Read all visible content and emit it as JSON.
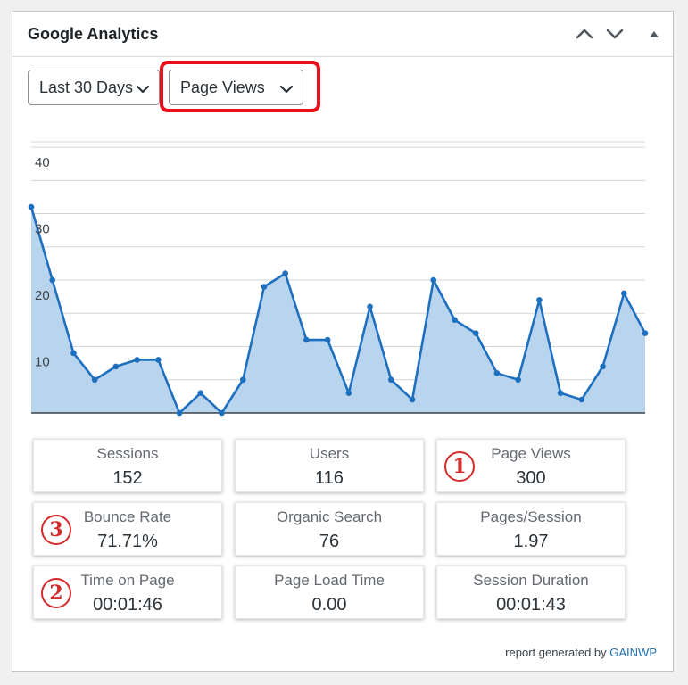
{
  "widget": {
    "title": "Google Analytics",
    "header_icons": [
      "chevron-up-icon",
      "chevron-down-icon",
      "triangle-up-icon"
    ]
  },
  "controls": {
    "period": {
      "selected": "Last 30 Days"
    },
    "metric": {
      "selected": "Page Views"
    }
  },
  "colors": {
    "line": "#1f6fbf",
    "area": "#b9d5ee",
    "highlight": "#e8111b",
    "marker": "#d62a2a",
    "link": "#2271b1"
  },
  "chart_data": {
    "type": "area",
    "title": "",
    "xlabel": "",
    "ylabel": "",
    "ylim": [
      0,
      40
    ],
    "yticks": [
      "10",
      "20",
      "30",
      "40"
    ],
    "grid": true,
    "series": [
      {
        "values": [
          31,
          20,
          9,
          5,
          7,
          8,
          8,
          0,
          3,
          0,
          5,
          19,
          21,
          11,
          11,
          3,
          16,
          5,
          2,
          20,
          14,
          12,
          6,
          5,
          17,
          3,
          2,
          7,
          18,
          12
        ]
      }
    ]
  },
  "stats": [
    {
      "label": "Sessions",
      "value": "152"
    },
    {
      "label": "Users",
      "value": "116"
    },
    {
      "label": "Page Views",
      "value": "300",
      "marker": "1"
    },
    {
      "label": "Bounce Rate",
      "value": "71.71%",
      "marker": "3"
    },
    {
      "label": "Organic Search",
      "value": "76"
    },
    {
      "label": "Pages/Session",
      "value": "1.97"
    },
    {
      "label": "Time on Page",
      "value": "00:01:46",
      "marker": "2"
    },
    {
      "label": "Page Load Time",
      "value": "0.00"
    },
    {
      "label": "Session Duration",
      "value": "00:01:43"
    }
  ],
  "footer": {
    "text": "report generated by",
    "link": "GAINWP"
  }
}
